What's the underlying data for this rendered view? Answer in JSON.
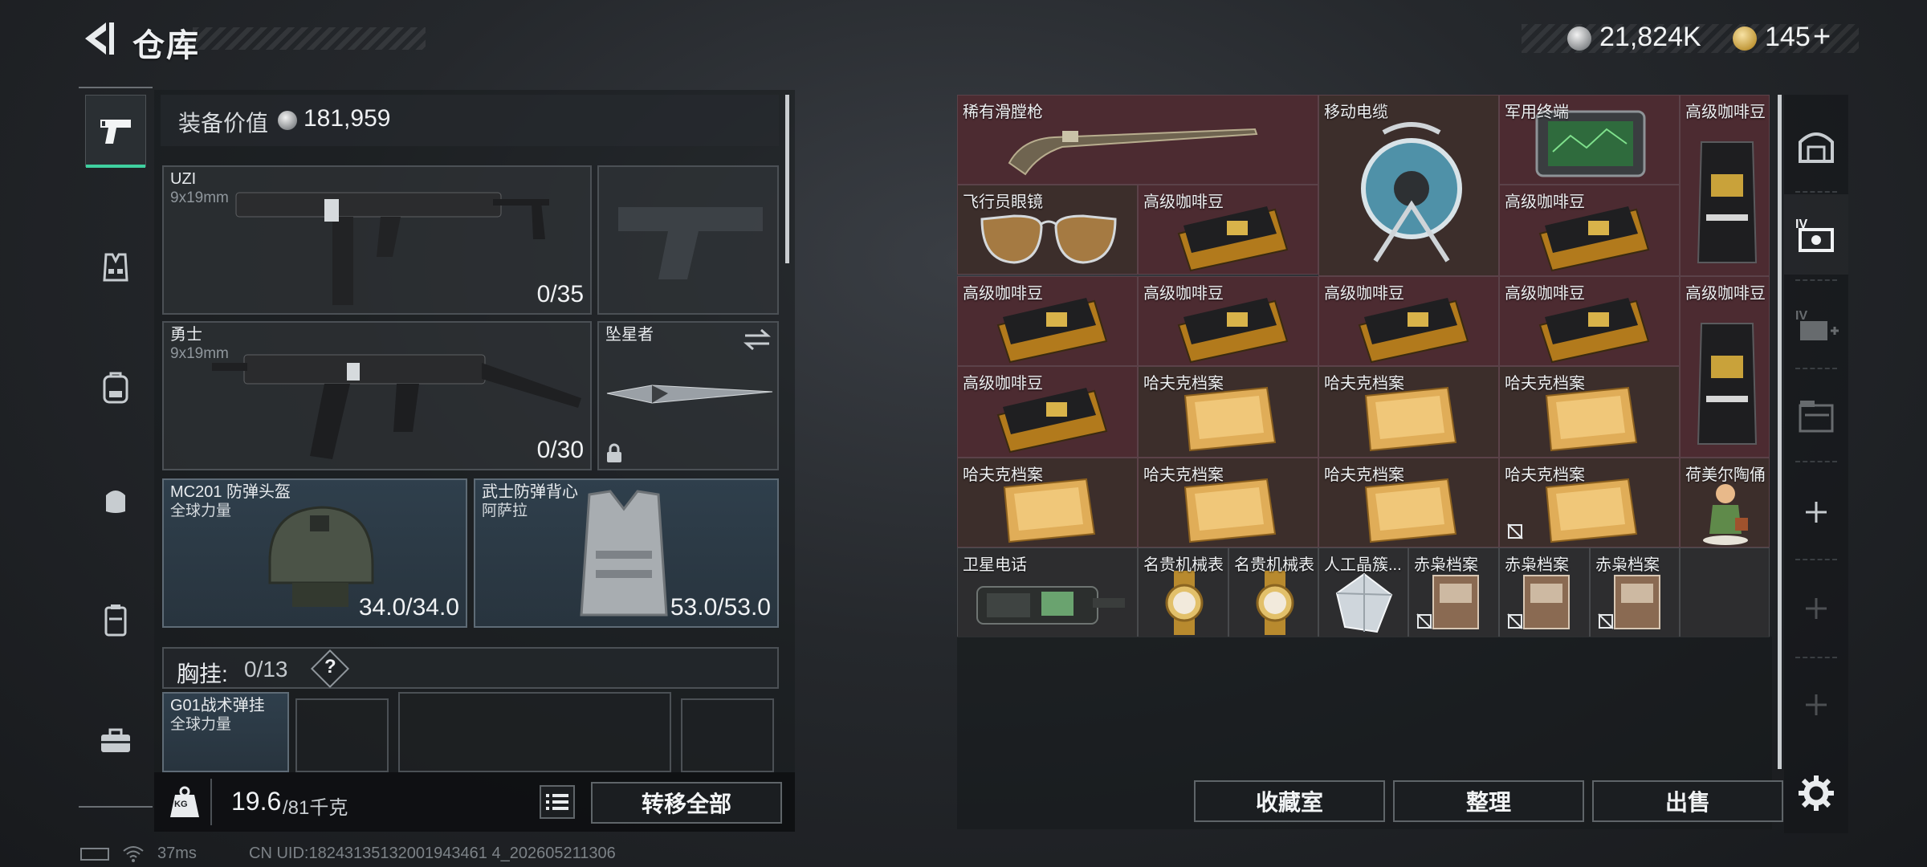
{
  "header": {
    "title": "仓库",
    "currency_silver": "21,824K",
    "currency_gold": "145",
    "gold_plus": "+"
  },
  "equipment": {
    "value_label": "装备价值",
    "value": "181,959",
    "primary": {
      "name": "UZI",
      "caliber": "9x19mm",
      "ammo": "0/35"
    },
    "secondary": {
      "name": "勇士",
      "caliber": "9x19mm",
      "ammo": "0/30"
    },
    "melee": {
      "name": "坠星者"
    },
    "helmet": {
      "name": "MC201 防弹头盔",
      "sub": "全球力量",
      "durability": "34.0/34.0"
    },
    "armor": {
      "name": "武士防弹背心",
      "sub": "阿萨拉",
      "durability": "53.0/53.0"
    },
    "chest_rig": {
      "label": "胸挂:",
      "capacity": "0/13",
      "help": "?"
    },
    "rig_item": {
      "name": "G01战术弹挂",
      "sub": "全球力量"
    },
    "weight_current": "19.6",
    "weight_max": "/81千克",
    "weight_icon_text": "KG",
    "transfer_all": "转移全部"
  },
  "storage": {
    "items": [
      {
        "label": "稀有滑膛枪",
        "icon": "musket"
      },
      {
        "label": "移动电缆",
        "icon": "cable-reel"
      },
      {
        "label": "军用终端",
        "icon": "military-terminal"
      },
      {
        "label": "高级咖啡豆",
        "icon": "coffee-bag"
      },
      {
        "label": "飞行员眼镜",
        "icon": "aviator-glasses"
      },
      {
        "label": "高级咖啡豆",
        "icon": "coffee-pack"
      },
      {
        "label": "高级咖啡豆",
        "icon": "coffee-pack"
      },
      {
        "label": "高级咖啡豆",
        "icon": "coffee-pack"
      },
      {
        "label": "高级咖啡豆",
        "icon": "coffee-pack"
      },
      {
        "label": "高级咖啡豆",
        "icon": "coffee-pack"
      },
      {
        "label": "高级咖啡豆",
        "icon": "coffee-pack"
      },
      {
        "label": "高级咖啡豆",
        "icon": "coffee-bag"
      },
      {
        "label": "高级咖啡豆",
        "icon": "coffee-pack"
      },
      {
        "label": "哈夫克档案",
        "icon": "hafk-file"
      },
      {
        "label": "哈夫克档案",
        "icon": "hafk-file"
      },
      {
        "label": "哈夫克档案",
        "icon": "hafk-file"
      },
      {
        "label": "哈夫克档案",
        "icon": "hafk-file"
      },
      {
        "label": "哈夫克档案",
        "icon": "hafk-file"
      },
      {
        "label": "哈夫克档案",
        "icon": "hafk-file"
      },
      {
        "label": "哈夫克档案",
        "icon": "hafk-file"
      },
      {
        "label": "荷美尔陶俑",
        "icon": "porcelain-figurine"
      },
      {
        "label": "卫星电话",
        "icon": "satellite-phone"
      },
      {
        "label": "名贵机械表",
        "icon": "gold-watch"
      },
      {
        "label": "名贵机械表",
        "icon": "gold-watch"
      },
      {
        "label": "人工晶簇...",
        "icon": "crystal"
      },
      {
        "label": "赤枭档案",
        "icon": "redowl-file"
      },
      {
        "label": "赤枭档案",
        "icon": "redowl-file"
      },
      {
        "label": "赤枭档案",
        "icon": "redowl-file"
      }
    ],
    "buttons": {
      "collection": "收藏室",
      "sort": "整理",
      "sell": "出售"
    }
  },
  "footer": {
    "ping": "37ms",
    "uid": "CN UID:18243135132001943461 4_202605211306"
  },
  "colors": {
    "accent": "#3fd0a0",
    "cell_red": "#4c2b31",
    "cell_brown": "#3c2e2b"
  }
}
